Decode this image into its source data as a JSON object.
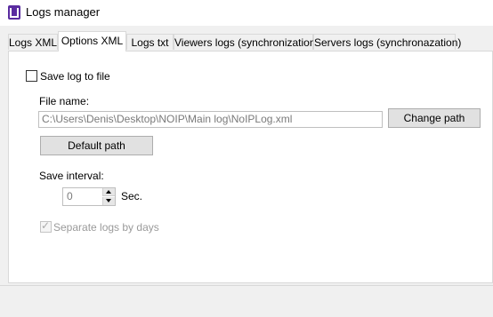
{
  "window": {
    "title": "Logs manager"
  },
  "tabs": [
    {
      "label": "Logs XML"
    },
    {
      "label": "Options XML"
    },
    {
      "label": "Logs txt"
    },
    {
      "label": "Viewers logs (synchronization)"
    },
    {
      "label": "Servers logs (synchronazation)"
    }
  ],
  "options": {
    "save_log_label": "Save log to file",
    "save_log_checked": false,
    "file_name_label": "File name:",
    "file_path_value": "C:\\Users\\Denis\\Desktop\\NOIP\\Main log\\NoIPLog.xml",
    "change_path_label": "Change path",
    "default_path_label": "Default path",
    "save_interval_label": "Save interval:",
    "interval_value": "0",
    "interval_unit": "Sec.",
    "separate_logs_label": "Separate logs by days",
    "separate_logs_checked": true
  },
  "colors": {
    "accent": "#0078d7",
    "app_icon": "#5a2ca0"
  }
}
